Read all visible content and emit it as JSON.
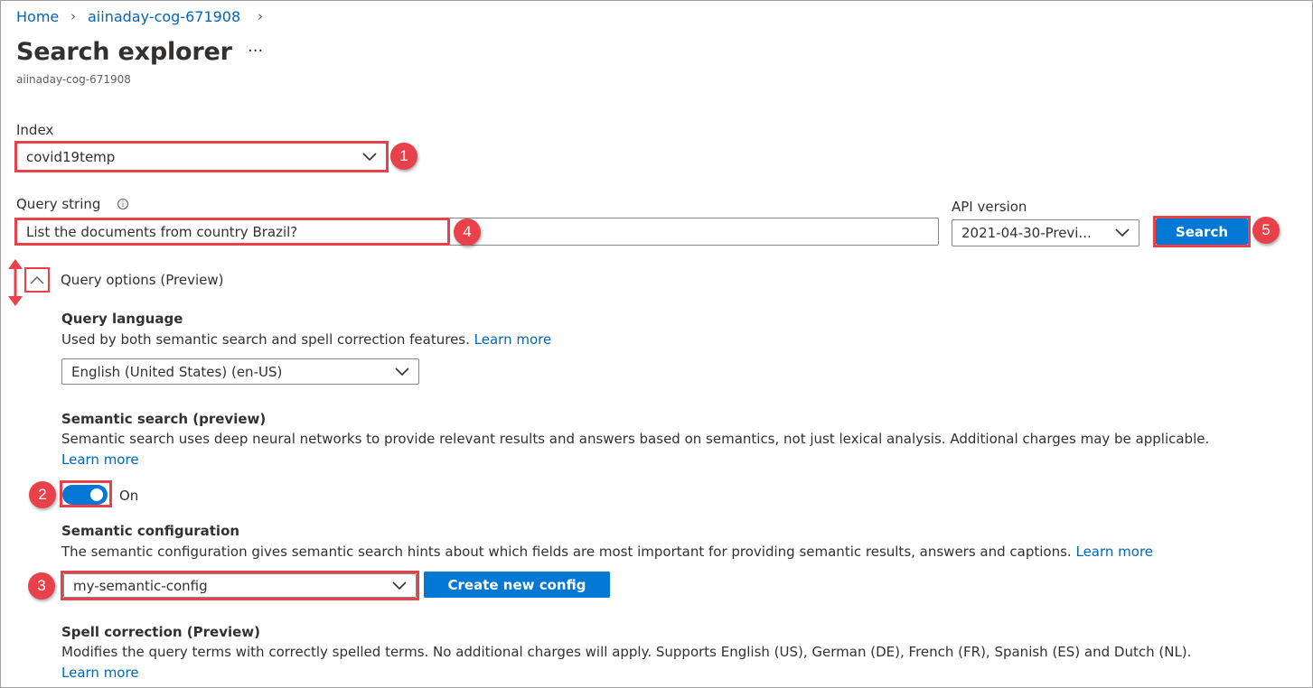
{
  "breadcrumb": {
    "home": "Home",
    "resource": "aiinaday-cog-671908"
  },
  "header": {
    "title": "Search explorer",
    "more": "···",
    "subtitle": "aiinaday-cog-671908"
  },
  "index": {
    "label": "Index",
    "selected": "covid19temp"
  },
  "query": {
    "label": "Query string",
    "value": "List the documents from country Brazil?",
    "api_label": "API version",
    "api_selected": "2021-04-30-Previ...",
    "search_button": "Search"
  },
  "query_options": {
    "label": "Query options (Preview)",
    "language": {
      "heading": "Query language",
      "desc": "Used by both semantic search and spell correction features.",
      "learn_more": "Learn more",
      "selected": "English (United States) (en-US)"
    },
    "semantic": {
      "heading": "Semantic search (preview)",
      "desc": "Semantic search uses deep neural networks to provide relevant results and answers based on semantics, not just lexical analysis. Additional charges may be applicable.",
      "learn_more": "Learn more",
      "toggle_state": "On"
    },
    "config": {
      "heading": "Semantic configuration",
      "desc": "The semantic configuration gives semantic search hints about which fields are most important for providing semantic results, answers and captions.",
      "learn_more": "Learn more",
      "selected": "my-semantic-config",
      "create_button": "Create new config"
    },
    "spell": {
      "heading": "Spell correction (Preview)",
      "desc": "Modifies the query terms with correctly spelled terms. No additional charges will apply. Supports English (US), German (DE), French (FR), Spanish (ES) and Dutch (NL).",
      "learn_more": "Learn more"
    }
  },
  "callouts": [
    "1",
    "2",
    "3",
    "4",
    "5"
  ],
  "colors": {
    "accent": "#0078d4",
    "link": "#0067b8",
    "highlight": "#e8414a"
  }
}
